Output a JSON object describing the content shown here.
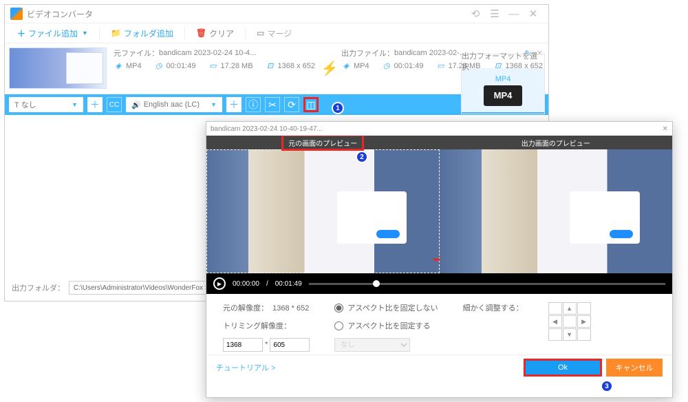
{
  "app_title": "ビデオコンバータ",
  "toolbar": {
    "add_file": "ファイル追加",
    "add_folder": "フォルダ追加",
    "clear": "クリア",
    "merge": "マージ"
  },
  "source": {
    "label": "元ファイル：",
    "name": "bandicam 2023-02-24 10-4...",
    "format": "MP4",
    "duration": "00:01:49",
    "size": "17.28 MB",
    "resolution": "1368 x 652"
  },
  "output": {
    "label": "出力ファイル：",
    "name": "bandicam 2023-02-...",
    "format": "MP4",
    "duration": "00:01:49",
    "size": "17.28 MB",
    "resolution": "1368 x 652"
  },
  "subtitle_dd": "T なし",
  "audio_dd": "English aac (LC)",
  "right_panel": {
    "title": "出力フォーマットを選択",
    "format": "MP4",
    "badge": "MP4"
  },
  "output_folder_label": "出力フォルダ：",
  "output_folder_path": "C:\\Users\\Administrator\\Videos\\WonderFox Soft\\HD Vid",
  "crop": {
    "window_title": "bandicam 2023-02-24 10-40-19-47...",
    "orig_preview": "元の画面のプレビュー",
    "out_preview": "出力画面のプレビュー",
    "time_current": "00:00:00",
    "time_total": "00:01:49",
    "orig_res_label": "元の解像度：",
    "orig_res_value": "1368 * 652",
    "trim_res_label": "トリミング解像度：",
    "trim_w": "1368",
    "trim_h": "605",
    "aspect_free": "アスペクト比を固定しない",
    "aspect_lock": "アスペクト比を固定する",
    "aspect_sel": "なし",
    "fine_label": "細かく調整する：",
    "tutorial": "チュートリアル >",
    "ok": "Ok",
    "cancel": "キャンセル"
  },
  "callouts": {
    "c1": "1",
    "c2": "2",
    "c3": "3"
  }
}
